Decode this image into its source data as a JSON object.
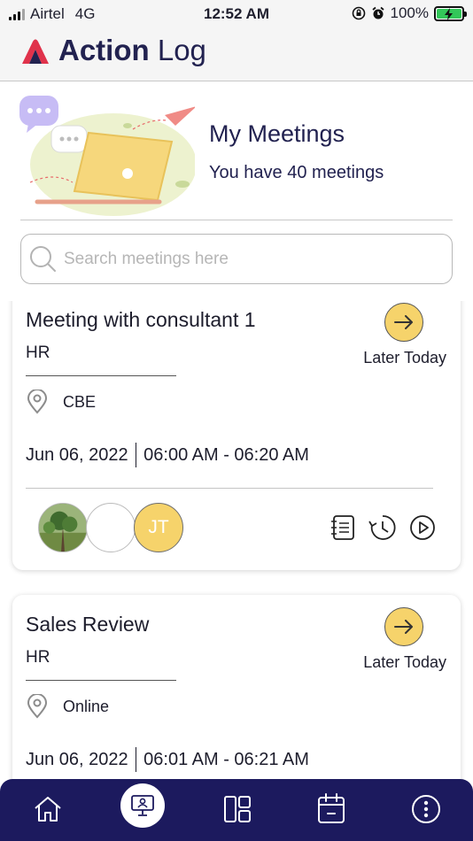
{
  "status_bar": {
    "carrier": "Airtel",
    "network": "4G",
    "time": "12:52 AM",
    "battery": "100%"
  },
  "app": {
    "brand_bold": "Action",
    "brand_light": "Log",
    "accent": "#222250",
    "logo_color": "#e0324b",
    "highlight": "#f6d36b",
    "nav_bg": "#1c1a5e"
  },
  "hero": {
    "title": "My Meetings",
    "subtitle": "You have 40 meetings"
  },
  "search": {
    "placeholder": "Search meetings here",
    "value": ""
  },
  "meetings": [
    {
      "title": "Meeting with consultant 1",
      "department": "HR",
      "status": "Later Today",
      "location": "CBE",
      "date": "Jun 06, 2022",
      "time_range": "06:00 AM - 06:20 AM",
      "participants": [
        {
          "type": "photo"
        },
        {
          "type": "blank"
        },
        {
          "type": "initials",
          "initials": "JT"
        }
      ]
    },
    {
      "title": "Sales Review",
      "department": "HR",
      "status": "Later Today",
      "location": "Online",
      "date": "Jun 06, 2022",
      "time_range": "06:01 AM - 06:21 AM"
    }
  ],
  "nav": {
    "items": [
      "home-icon",
      "meetings-icon",
      "dashboard-icon",
      "calendar-icon",
      "more-icon"
    ],
    "active": "meetings-icon"
  }
}
